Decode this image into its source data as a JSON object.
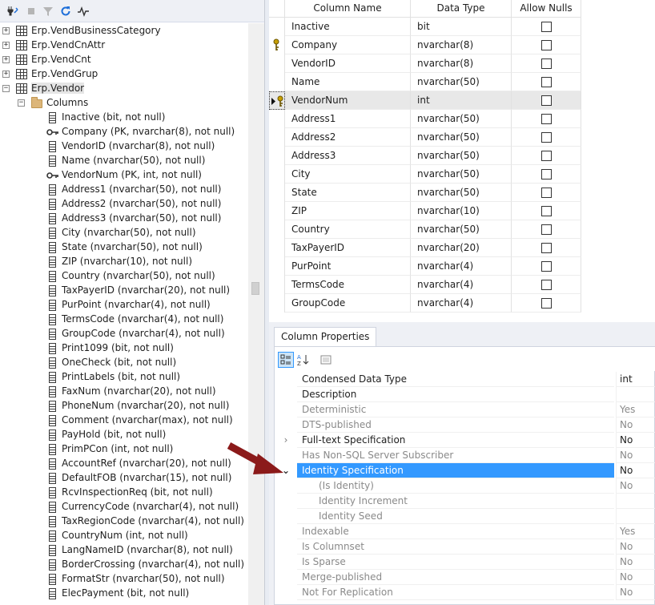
{
  "tree": {
    "tables": [
      {
        "label": "Erp.VendBusinessCategory",
        "expander": "+"
      },
      {
        "label": "Erp.VendCnAttr",
        "expander": "+"
      },
      {
        "label": "Erp.VendCnt",
        "expander": "+"
      },
      {
        "label": "Erp.VendGrup",
        "expander": "+"
      },
      {
        "label": "Erp.Vendor",
        "expander": "−"
      }
    ],
    "columns_folder": {
      "label": "Columns",
      "expander": "−"
    },
    "columns": [
      {
        "label": "Inactive (bit, not null)",
        "key": false
      },
      {
        "label": "Company (PK, nvarchar(8), not null)",
        "key": true
      },
      {
        "label": "VendorID (nvarchar(8), not null)",
        "key": false
      },
      {
        "label": "Name (nvarchar(50), not null)",
        "key": false
      },
      {
        "label": "VendorNum (PK, int, not null)",
        "key": true
      },
      {
        "label": "Address1 (nvarchar(50), not null)",
        "key": false
      },
      {
        "label": "Address2 (nvarchar(50), not null)",
        "key": false
      },
      {
        "label": "Address3 (nvarchar(50), not null)",
        "key": false
      },
      {
        "label": "City (nvarchar(50), not null)",
        "key": false
      },
      {
        "label": "State (nvarchar(50), not null)",
        "key": false
      },
      {
        "label": "ZIP (nvarchar(10), not null)",
        "key": false
      },
      {
        "label": "Country (nvarchar(50), not null)",
        "key": false
      },
      {
        "label": "TaxPayerID (nvarchar(20), not null)",
        "key": false
      },
      {
        "label": "PurPoint (nvarchar(4), not null)",
        "key": false
      },
      {
        "label": "TermsCode (nvarchar(4), not null)",
        "key": false
      },
      {
        "label": "GroupCode (nvarchar(4), not null)",
        "key": false
      },
      {
        "label": "Print1099 (bit, not null)",
        "key": false
      },
      {
        "label": "OneCheck (bit, not null)",
        "key": false
      },
      {
        "label": "PrintLabels (bit, not null)",
        "key": false
      },
      {
        "label": "FaxNum (nvarchar(20), not null)",
        "key": false
      },
      {
        "label": "PhoneNum (nvarchar(20), not null)",
        "key": false
      },
      {
        "label": "Comment (nvarchar(max), not null)",
        "key": false
      },
      {
        "label": "PayHold (bit, not null)",
        "key": false
      },
      {
        "label": "PrimPCon (int, not null)",
        "key": false
      },
      {
        "label": "AccountRef (nvarchar(20), not null)",
        "key": false
      },
      {
        "label": "DefaultFOB (nvarchar(15), not null)",
        "key": false
      },
      {
        "label": "RcvInspectionReq (bit, not null)",
        "key": false
      },
      {
        "label": "CurrencyCode (nvarchar(4), not null)",
        "key": false
      },
      {
        "label": "TaxRegionCode (nvarchar(4), not null)",
        "key": false
      },
      {
        "label": "CountryNum (int, not null)",
        "key": false
      },
      {
        "label": "LangNameID (nvarchar(8), not null)",
        "key": false
      },
      {
        "label": "BorderCrossing (nvarchar(4), not null)",
        "key": false
      },
      {
        "label": "FormatStr (nvarchar(50), not null)",
        "key": false
      },
      {
        "label": "ElecPayment (bit, not null)",
        "key": false
      }
    ]
  },
  "grid": {
    "headers": {
      "name": "Column Name",
      "type": "Data Type",
      "nulls": "Allow Nulls"
    },
    "rows": [
      {
        "name": "Inactive",
        "type": "bit",
        "marker": ""
      },
      {
        "name": "Company",
        "type": "nvarchar(8)",
        "marker": "key"
      },
      {
        "name": "VendorID",
        "type": "nvarchar(8)",
        "marker": ""
      },
      {
        "name": "Name",
        "type": "nvarchar(50)",
        "marker": ""
      },
      {
        "name": "VendorNum",
        "type": "int",
        "marker": "current-key"
      },
      {
        "name": "Address1",
        "type": "nvarchar(50)",
        "marker": ""
      },
      {
        "name": "Address2",
        "type": "nvarchar(50)",
        "marker": ""
      },
      {
        "name": "Address3",
        "type": "nvarchar(50)",
        "marker": ""
      },
      {
        "name": "City",
        "type": "nvarchar(50)",
        "marker": ""
      },
      {
        "name": "State",
        "type": "nvarchar(50)",
        "marker": ""
      },
      {
        "name": "ZIP",
        "type": "nvarchar(10)",
        "marker": ""
      },
      {
        "name": "Country",
        "type": "nvarchar(50)",
        "marker": ""
      },
      {
        "name": "TaxPayerID",
        "type": "nvarchar(20)",
        "marker": ""
      },
      {
        "name": "PurPoint",
        "type": "nvarchar(4)",
        "marker": ""
      },
      {
        "name": "TermsCode",
        "type": "nvarchar(4)",
        "marker": ""
      },
      {
        "name": "GroupCode",
        "type": "nvarchar(4)",
        "marker": ""
      }
    ]
  },
  "properties": {
    "tab_label": "Column Properties",
    "rows": [
      {
        "name": "Condensed Data Type",
        "value": "int",
        "state": "normal",
        "glyph": ""
      },
      {
        "name": "Description",
        "value": "",
        "state": "normal",
        "glyph": ""
      },
      {
        "name": "Deterministic",
        "value": "Yes",
        "state": "disabled",
        "glyph": ""
      },
      {
        "name": "DTS-published",
        "value": "No",
        "state": "disabled",
        "glyph": ""
      },
      {
        "name": "Full-text Specification",
        "value": "No",
        "state": "normal",
        "glyph": "›"
      },
      {
        "name": "Has Non-SQL Server Subscriber",
        "value": "No",
        "state": "disabled",
        "glyph": ""
      },
      {
        "name": "Identity Specification",
        "value": "No",
        "state": "selected",
        "glyph": "⌄"
      },
      {
        "name": "(Is Identity)",
        "value": "No",
        "state": "child-disabled",
        "glyph": ""
      },
      {
        "name": "Identity Increment",
        "value": "",
        "state": "child-disabled",
        "glyph": ""
      },
      {
        "name": "Identity Seed",
        "value": "",
        "state": "child-disabled",
        "glyph": ""
      },
      {
        "name": "Indexable",
        "value": "Yes",
        "state": "disabled",
        "glyph": ""
      },
      {
        "name": "Is Columnset",
        "value": "No",
        "state": "disabled",
        "glyph": ""
      },
      {
        "name": "Is Sparse",
        "value": "No",
        "state": "disabled",
        "glyph": ""
      },
      {
        "name": "Merge-published",
        "value": "No",
        "state": "disabled",
        "glyph": ""
      },
      {
        "name": "Not For Replication",
        "value": "No",
        "state": "disabled",
        "glyph": ""
      }
    ]
  },
  "icons": {
    "toolbar": [
      "connect-icon",
      "stop-icon",
      "filter-icon",
      "refresh-icon",
      "activity-monitor-icon"
    ],
    "props_toolbar": [
      "categorized-icon",
      "alphabetical-icon",
      "property-pages-icon"
    ]
  },
  "colors": {
    "selection": "#3399ff",
    "arrow": "#8b1a1a",
    "key": "#c8a000"
  }
}
